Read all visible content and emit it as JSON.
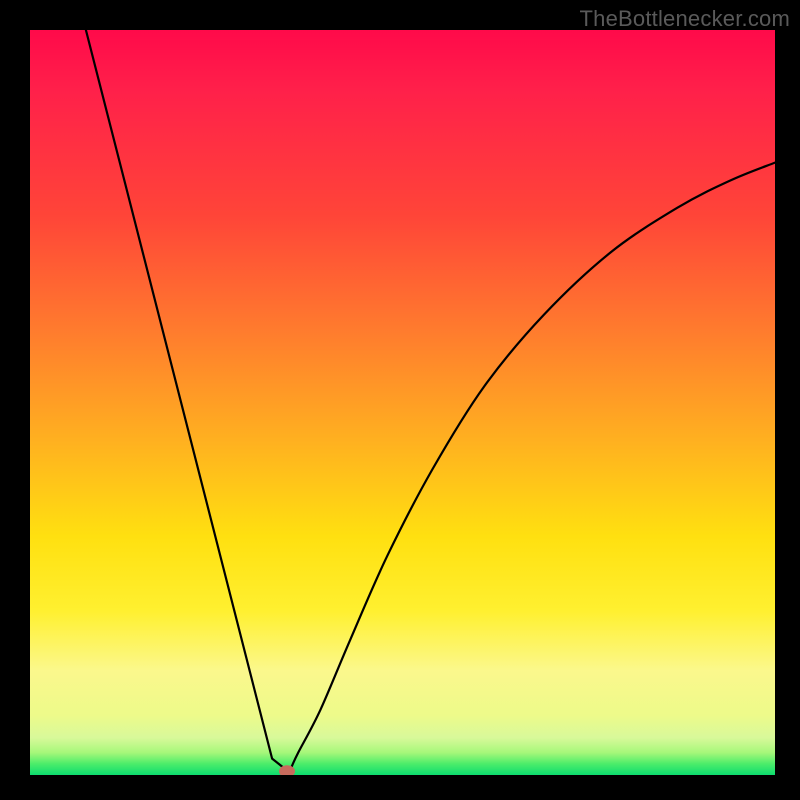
{
  "watermark": "TheBottlenecker.com",
  "chart_data": {
    "type": "line",
    "title": "",
    "xlabel": "",
    "ylabel": "",
    "xlim": [
      0,
      745
    ],
    "ylim": [
      0,
      745
    ],
    "description": "V-shaped bottleneck curve: steep linear descent from top-left to a minimum near x≈0.34 of width, then a damped exponential-like rise to the right.",
    "minimum_marker": {
      "x_frac": 0.345,
      "y_frac": 0.995,
      "color": "#c76b5d"
    },
    "series": [
      {
        "name": "bottleneck-curve",
        "points_xy_frac": [
          [
            0.075,
            0.0
          ],
          [
            0.325,
            0.978
          ],
          [
            0.34,
            0.99
          ],
          [
            0.36,
            0.97
          ],
          [
            0.39,
            0.912
          ],
          [
            0.43,
            0.818
          ],
          [
            0.48,
            0.705
          ],
          [
            0.54,
            0.59
          ],
          [
            0.61,
            0.478
          ],
          [
            0.69,
            0.382
          ],
          [
            0.78,
            0.298
          ],
          [
            0.87,
            0.238
          ],
          [
            0.94,
            0.202
          ],
          [
            1.0,
            0.178
          ]
        ]
      }
    ],
    "background_gradient": {
      "stops": [
        {
          "pos": 0.0,
          "color": "#ff0a4a"
        },
        {
          "pos": 0.4,
          "color": "#ff7a2e"
        },
        {
          "pos": 0.7,
          "color": "#ffe010"
        },
        {
          "pos": 0.92,
          "color": "#edfa8a"
        },
        {
          "pos": 1.0,
          "color": "#0ddc6f"
        }
      ]
    }
  }
}
